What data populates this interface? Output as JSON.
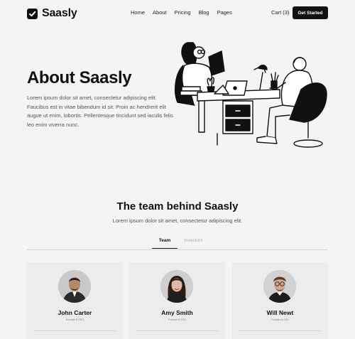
{
  "brand": {
    "name": "Saasly"
  },
  "nav": {
    "items": [
      "Home",
      "About",
      "Pricing",
      "Blog",
      "Pages"
    ]
  },
  "cart": {
    "label": "Cart (3)"
  },
  "cta": {
    "label": "Get Started"
  },
  "hero": {
    "title": "About Saasly",
    "text": "Lorem ipsum dolor sit amet, consectetur adipiscing elit. Faucibus est in vitae bibendum id sit. Proin ac hendrerit elit augue ut enim, lobortis. Pellentesque tincidunt sed iaculis felis leo enim viverra nunc."
  },
  "team": {
    "title": "The team behind Saasly",
    "subtitle": "Lorem ipsum dolor sit amet, consectetur adipiscing elit.",
    "tabs": [
      "Team",
      "Investors"
    ],
    "members": [
      {
        "name": "John Carter",
        "role": "Founder & CEO"
      },
      {
        "name": "Amy Smith",
        "role": "Founder & CTO"
      },
      {
        "name": "Will Newt",
        "role": "Founder & COO"
      }
    ]
  },
  "colors": {
    "accent": "#111111",
    "background": "#f4f4f4",
    "card": "#ececec"
  }
}
